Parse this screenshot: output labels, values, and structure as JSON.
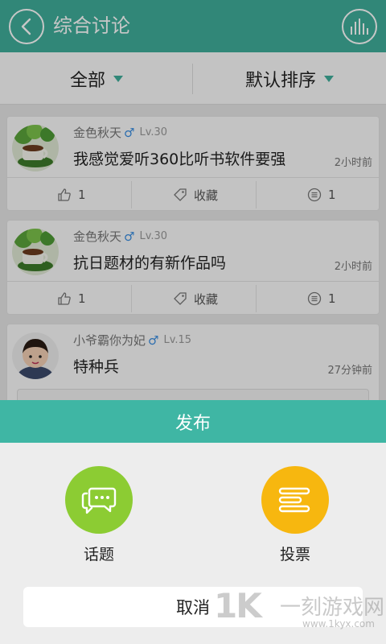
{
  "header": {
    "title": "综合讨论",
    "back_icon": "back-icon",
    "stats_icon": "bar-chart-icon"
  },
  "filters": {
    "left_label": "全部",
    "right_label": "默认排序"
  },
  "posts": [
    {
      "username": "金色秋天",
      "gender": "♂",
      "level": "Lv.30",
      "title": "我感觉爱听360比听书软件要强",
      "time": "2小时前",
      "likes": "1",
      "favorite": "收藏",
      "comments": "1"
    },
    {
      "username": "金色秋天",
      "gender": "♂",
      "level": "Lv.30",
      "title": "抗日题材的有新作品吗",
      "time": "2小时前",
      "likes": "1",
      "favorite": "收藏",
      "comments": "1"
    },
    {
      "username": "小爷霸你为妃",
      "gender": "♂",
      "level": "Lv.15",
      "title": "特种兵",
      "time": "27分钟前"
    }
  ],
  "sheet": {
    "title": "发布",
    "topic_label": "话题",
    "vote_label": "投票",
    "cancel_label": "取消"
  },
  "watermark": {
    "logo": "1K",
    "text": "一刻游戏网",
    "url": "www.1kyx.com"
  },
  "colors": {
    "accent": "#3fae9a",
    "topic": "#8ccc33",
    "vote": "#f7b70f"
  }
}
